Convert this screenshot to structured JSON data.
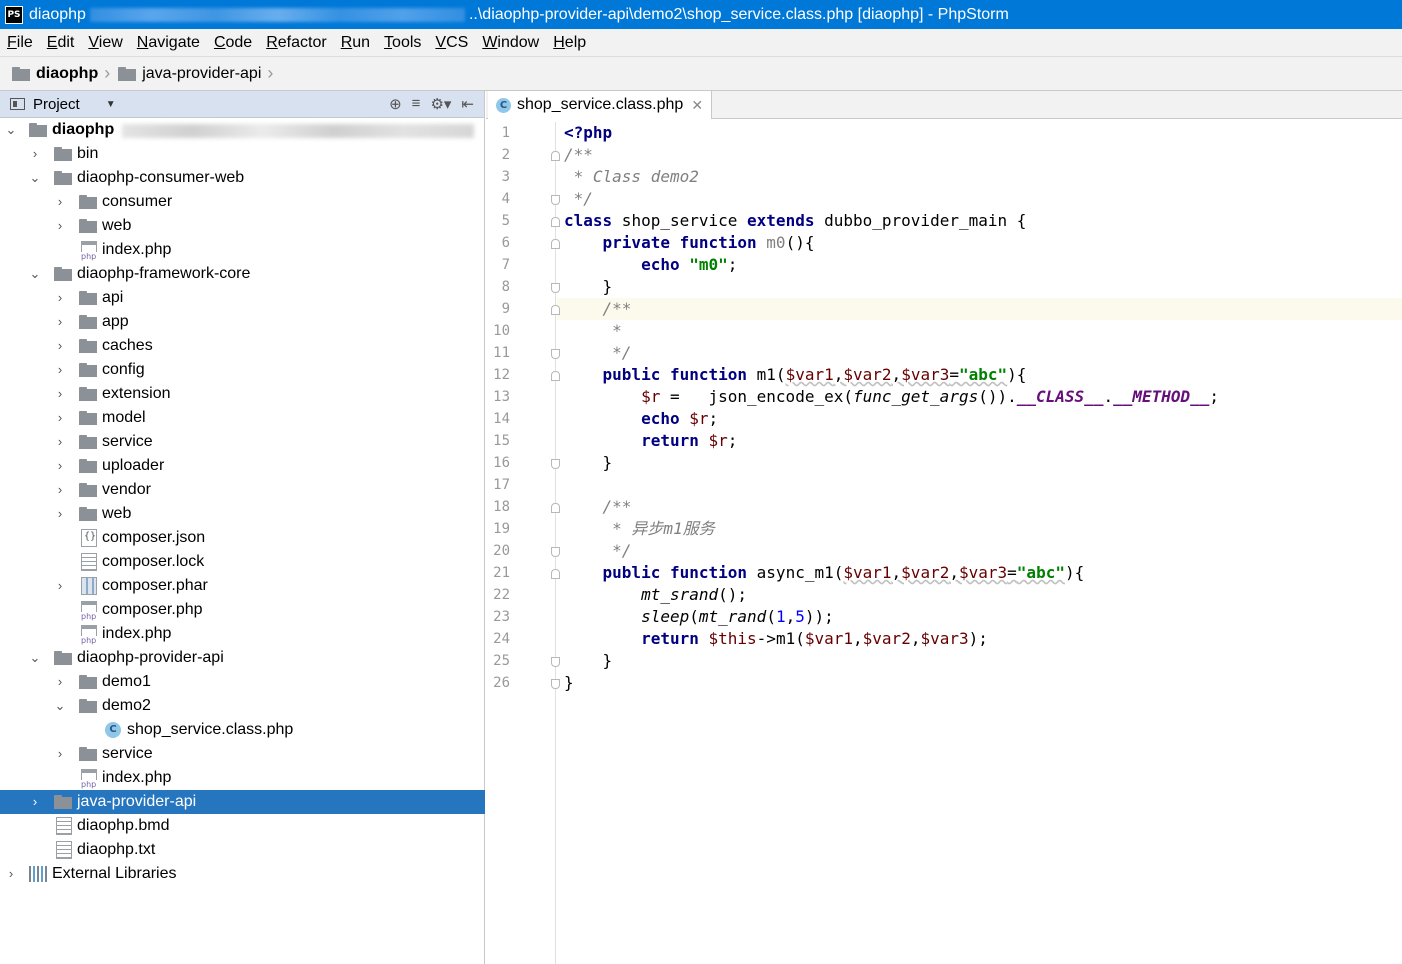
{
  "titlebar": {
    "app_icon": "PS",
    "project": "diaophp",
    "path_suffix": "..\\diaophp-provider-api\\demo2\\shop_service.class.php [diaophp] - PhpStorm"
  },
  "menu": [
    "File",
    "Edit",
    "View",
    "Navigate",
    "Code",
    "Refactor",
    "Run",
    "Tools",
    "VCS",
    "Window",
    "Help"
  ],
  "breadcrumb": [
    "diaophp",
    "java-provider-api"
  ],
  "project_panel": {
    "title": "Project",
    "tree": {
      "root": "diaophp",
      "bin": "bin",
      "consumer_web": "diaophp-consumer-web",
      "consumer": "consumer",
      "web1": "web",
      "index1": "index.php",
      "framework": "diaophp-framework-core",
      "api": "api",
      "app": "app",
      "caches": "caches",
      "config": "config",
      "extension": "extension",
      "model": "model",
      "service1": "service",
      "uploader": "uploader",
      "vendor": "vendor",
      "web2": "web",
      "composer_json": "composer.json",
      "composer_lock": "composer.lock",
      "composer_phar": "composer.phar",
      "composer_php": "composer.php",
      "index2": "index.php",
      "provider_api": "diaophp-provider-api",
      "demo1": "demo1",
      "demo2": "demo2",
      "shop_service": "shop_service.class.php",
      "service2": "service",
      "index3": "index.php",
      "java_provider": "java-provider-api",
      "bmd": "diaophp.bmd",
      "txt": "diaophp.txt",
      "ext_libs": "External Libraries"
    }
  },
  "editor": {
    "tab_label": "shop_service.class.php",
    "line_numbers": [
      "1",
      "2",
      "3",
      "4",
      "5",
      "6",
      "7",
      "8",
      "9",
      "10",
      "11",
      "12",
      "13",
      "14",
      "15",
      "16",
      "17",
      "18",
      "19",
      "20",
      "21",
      "22",
      "23",
      "24",
      "25",
      "26"
    ],
    "code": {
      "l1": "<?php",
      "l2": "/**",
      "l3": " * Class demo2",
      "l4": " */",
      "l5_kw": "class",
      "l5_name": " shop_service ",
      "l5_ext": "extends",
      "l5_rest": " dubbo_provider_main {",
      "l6_kw": "private function",
      "l6_fn": " m0",
      "l6_rest": "(){",
      "l7_kw": "echo",
      "l7_str": "\"m0\"",
      "l8": "}",
      "l9": "/**",
      "l10": " *",
      "l11": " */",
      "l12_kw": "public function",
      "l12_fn": " m1(",
      "l12_v1": "$var1",
      "l12_v2": "$var2",
      "l12_v3": "$var3",
      "l12_str": "\"abc\"",
      "l13_var": "$r",
      "l13_mid": " =   json_encode_ex(",
      "l13_fn": "func_get_args",
      "l13_mid2": "()).",
      "l13_c1": "__CLASS__",
      "l13_dot": ".",
      "l13_c2": "__METHOD__",
      "l14_kw": "echo",
      "l14_var": "$r",
      "l15_kw": "return",
      "l15_var": "$r",
      "l16": "}",
      "l18": "/**",
      "l19": " * 异步m1服务",
      "l20": " */",
      "l21_kw": "public function",
      "l21_fn": " async_m1(",
      "l21_v1": "$var1",
      "l21_v2": "$var2",
      "l21_v3": "$var3",
      "l21_str": "\"abc\"",
      "l22_fn": "mt_srand",
      "l23_fn": "sleep",
      "l23_fn2": "mt_rand",
      "l23_n1": "1",
      "l23_n2": "5",
      "l24_kw": "return",
      "l24_var": "$this",
      "l24_mid": "->m1(",
      "l24_v1": "$var1",
      "l24_v2": "$var2",
      "l24_v3": "$var3",
      "l25": "}",
      "l26": "}"
    }
  },
  "colors": {
    "titlebar": "#0078d7",
    "selection": "#2675bf",
    "keyword": "#000080",
    "string": "#008000",
    "variable": "#660000",
    "comment": "#808080",
    "constant": "#660e7a",
    "number": "#0000ff",
    "current_line": "#fcfaed"
  }
}
